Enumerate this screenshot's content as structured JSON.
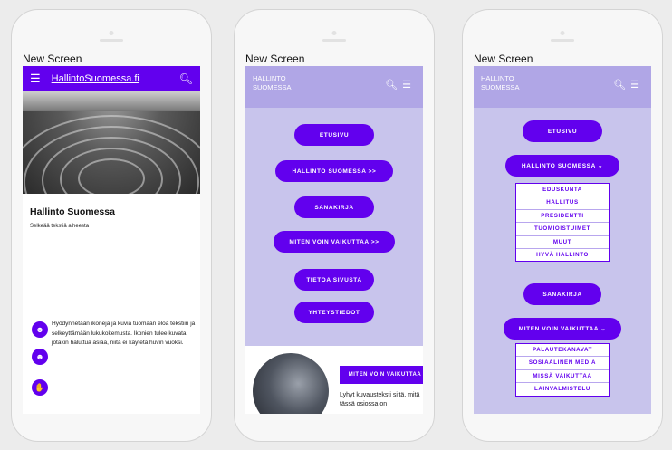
{
  "phones": [
    {
      "label": "New Screen",
      "app_title": "HallintoSuomessa.fi",
      "heading": "Hallinto Suomessa",
      "body": "Selkeää tekstiä aiheesta",
      "description": "Hyödynnetään ikoneja ja kuvia tuomaan eloa tekstiin ja selkeyttämään lukukokemusta. Ikonien tulee kuvata jotakin haluttua asiaa, niitä ei käytetä huvin vuoksi."
    },
    {
      "label": "New Screen",
      "app_title_line1": "HALLINTO",
      "app_title_line2": "SUOMESSA",
      "menu": [
        "ETUSIVU",
        "HALLINTO SUOMESSA >>",
        "SANAKIRJA",
        "MITEN VOIN VAIKUTTAA >>",
        "TIETOA SIVUSTA",
        "YHTEYSTIEDOT"
      ],
      "card_button": "MITEN VOIN VAIKUTTAA",
      "card_text": "Lyhyt kuvausteksti siitä, mitä tässä osiossa on"
    },
    {
      "label": "New Screen",
      "app_title_line1": "HALLINTO",
      "app_title_line2": "SUOMESSA",
      "menu_top": "ETUSIVU",
      "menu_hallinto": "HALLINTO SUOMESSA ⌄",
      "submenu_hallinto": [
        "EDUSKUNTA",
        "HALLITUS",
        "PRESIDENTTI",
        "TUOMIOISTUIMET",
        "MUUT",
        "HYVÄ HALLINTO"
      ],
      "menu_sanakirja": "SANAKIRJA",
      "menu_vaikuttaa": "MITEN VOIN VAIKUTTAA ⌄",
      "submenu_vaikuttaa": [
        "PALAUTEKANAVAT",
        "SOSIAALINEN MEDIA",
        "MISSÄ VAIKUTTAA",
        "LAINVALMISTELU"
      ]
    }
  ],
  "icons": {
    "menu": "☰",
    "search": "⚲",
    "face": "☻",
    "hand": "✋"
  },
  "colors": {
    "primary": "#6200ee",
    "lavender": "#c8c4ec",
    "lavender_bar": "#b0a6e6"
  }
}
